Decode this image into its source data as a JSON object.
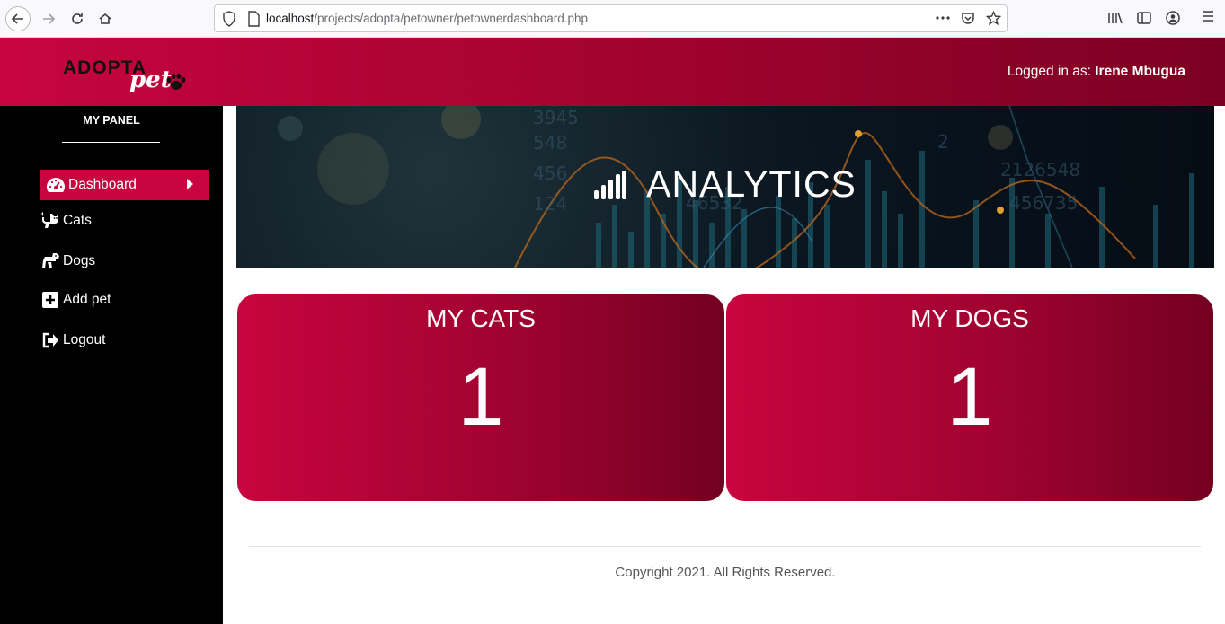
{
  "browser": {
    "url_host": "localhost",
    "url_path": "/projects/adopta/petowner/petownerdashboard.php"
  },
  "header": {
    "logo_main": "ADOPTA",
    "logo_sub": "pet",
    "login_prefix": "Logged in as: ",
    "login_name": "Irene Mbugua",
    "accent": "#c8053e"
  },
  "sidebar": {
    "title": "MY PANEL",
    "items": [
      {
        "label": "Dashboard",
        "icon": "tachometer-icon",
        "active": true
      },
      {
        "label": "Cats",
        "icon": "cat-icon",
        "active": false
      },
      {
        "label": "Dogs",
        "icon": "dog-icon",
        "active": false
      },
      {
        "label": "Add pet",
        "icon": "plus-square-icon",
        "active": false
      },
      {
        "label": "Logout",
        "icon": "sign-out-icon",
        "active": false
      }
    ]
  },
  "banner": {
    "title": "ANALYTICS",
    "icon": "signal-bars-icon"
  },
  "cards": [
    {
      "title": "MY CATS",
      "value": "1"
    },
    {
      "title": "MY DOGS",
      "value": "1"
    }
  ],
  "footer": {
    "text": "Copyright 2021. All Rights Reserved."
  }
}
